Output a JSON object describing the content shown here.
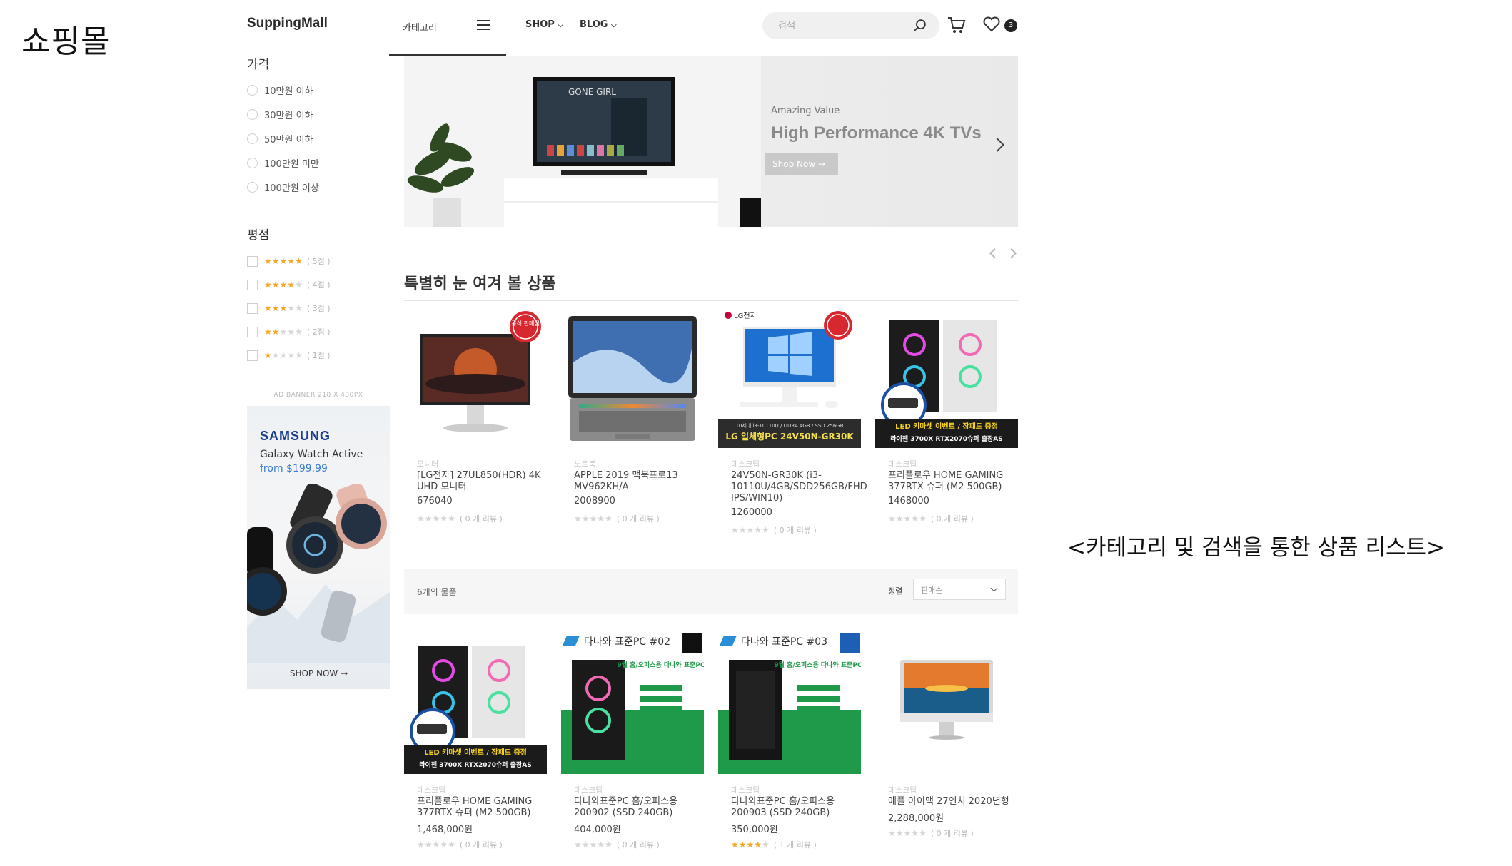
{
  "page_heading": "쇼핑몰",
  "caption": "<카테고리 및 검색을 통한 상품 리스트>",
  "header": {
    "logo": "SuppingMall",
    "category_tab": "카테고리",
    "nav": [
      {
        "label": "SHOP"
      },
      {
        "label": "BLOG"
      }
    ],
    "search_placeholder": "검색",
    "wishlist_count": "3"
  },
  "sidebar": {
    "price_title": "가격",
    "price_options": [
      "10만원 이하",
      "30만원 이하",
      "50만원 이하",
      "100만원 미만",
      "100만원 이상"
    ],
    "rating_title": "평점",
    "rating_options": [
      {
        "stars": 5,
        "label": "( 5점 )"
      },
      {
        "stars": 4,
        "label": "( 4점 )"
      },
      {
        "stars": 3,
        "label": "( 3점 )"
      },
      {
        "stars": 2,
        "label": "( 2점 )"
      },
      {
        "stars": 1,
        "label": "( 1점 )"
      }
    ],
    "ad_note": "AD BANNER 218 X 430PX",
    "ad": {
      "brand": "SAMSUNG",
      "product": "Galaxy Watch Active",
      "price": "from $199.99",
      "cta": "SHOP NOW →"
    }
  },
  "hero": {
    "subtitle": "Amazing Value",
    "title": "High Performance 4K TVs",
    "button": "Shop Now →"
  },
  "featured": {
    "title": "특별히 눈 여겨 볼 상품",
    "products": [
      {
        "category": "모니터",
        "name": "[LG전자] 27UL850(HDR) 4K UHD 모니터",
        "price": "676040",
        "rating": 0,
        "reviews": "( 0 개 리뷰 )"
      },
      {
        "category": "노트북",
        "name": "APPLE 2019 맥북프로13 MV962KH/A",
        "price": "2008900",
        "rating": 0,
        "reviews": "( 0 개 리뷰 )"
      },
      {
        "category": "데스크탑",
        "name": "24V50N-GR30K (i3-10110U/4GB/SDD256GB/FHD IPS/WIN10)",
        "price": "1260000",
        "rating": 0,
        "reviews": "( 0 개 리뷰 )"
      },
      {
        "category": "데스크탑",
        "name": "프리플로우 HOME GAMING 377RTX 슈퍼 (M2 500GB)",
        "price": "1468000",
        "rating": 0,
        "reviews": "( 0 개 리뷰 )"
      }
    ]
  },
  "listing": {
    "result_count": "6개의 물품",
    "sort_label": "정렬",
    "sort_value": "판매순",
    "products": [
      {
        "category": "데스크탑",
        "name": "프리플로우 HOME GAMING 377RTX 슈퍼 (M2 500GB)",
        "price": "1,468,000원",
        "rating": 0,
        "reviews": "( 0 개 리뷰 )"
      },
      {
        "category": "데스크탑",
        "name": "다나와표준PC 홈/오피스용 200902 (SSD 240GB)",
        "price": "404,000원",
        "rating": 0,
        "reviews": "( 0 개 리뷰 )"
      },
      {
        "category": "데스크탑",
        "name": "다나와표준PC 홈/오피스용 200903 (SSD 240GB)",
        "price": "350,000원",
        "rating": 4,
        "reviews": "( 1 개 리뷰 )"
      },
      {
        "category": "데스크탑",
        "name": "애플 아이맥 27인치 2020년형",
        "price": "2,288,000원",
        "rating": 0,
        "reviews": "( 0 개 리뷰 )"
      }
    ]
  },
  "image_text": {
    "official_badge": "공식 판매점",
    "lg_logo": "LG전자",
    "lg_strip": "LG 일체형PC 24V50N-GR30K",
    "lg_spec": "10세대 i3-10110U / DDR4 4GB / SSD 256GB",
    "gaming_event": "LED 키마셋 이벤트 / 장패드 증정",
    "gaming_spec": "라이젠 3700X RTX2070슈퍼 출장AS",
    "danawa_02": "다나와 표준PC #02",
    "danawa_03": "다나와 표준PC #03",
    "danawa_promo": "9월 홈/오피스용 다나와 표준PC"
  },
  "colors": {
    "accent": "#f5a623",
    "ad_brand": "#1b3d8f",
    "badge": "#d7282f",
    "danawa_green": "#1e9a4a"
  }
}
